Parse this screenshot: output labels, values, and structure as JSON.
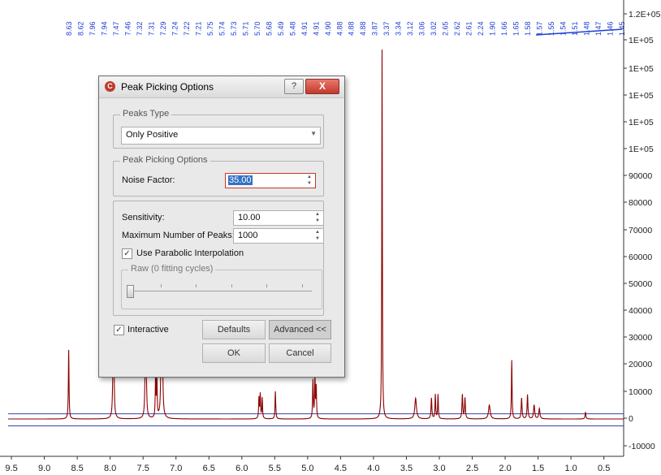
{
  "chart_data": {
    "type": "line",
    "title": "",
    "xlabel": "",
    "ylabel": "",
    "x_ticks": [
      "9.5",
      "9.0",
      "8.5",
      "8.0",
      "7.5",
      "7.0",
      "6.5",
      "6.0",
      "5.5",
      "5.0",
      "4.5",
      "4.0",
      "3.5",
      "3.0",
      "2.5",
      "2.0",
      "1.5",
      "1.0",
      "0.5"
    ],
    "y_ticks": [
      "1.2E+05",
      "1E+05",
      "1E+05",
      "1E+05",
      "1E+05",
      "1E+05",
      "90000",
      "80000",
      "70000",
      "60000",
      "50000",
      "40000",
      "30000",
      "20000",
      "10000",
      "0",
      "-10000"
    ],
    "xlim": [
      9.55,
      0.2
    ],
    "ylim": [
      -12000,
      119000
    ],
    "peak_labels": [
      "8.63",
      "8.62",
      "7.96",
      "7.94",
      "7.47",
      "7.46",
      "7.32",
      "7.31",
      "7.29",
      "7.24",
      "7.22",
      "7.21",
      "5.75",
      "5.74",
      "5.73",
      "5.71",
      "5.70",
      "5.68",
      "5.49",
      "5.48",
      "4.91",
      "4.91",
      "4.90",
      "4.88",
      "4.88",
      "4.88",
      "3.87",
      "3.37",
      "3.34",
      "3.12",
      "3.06",
      "3.02",
      "2.65",
      "2.62",
      "2.61",
      "2.24",
      "1.90",
      "1.66",
      "1.65",
      "1.58",
      "1.57",
      "1.55",
      "1.54",
      "1.51",
      "1.48",
      "1.47",
      "1.46",
      "1.45"
    ],
    "series": [
      {
        "color": "#8b0000",
        "peaks": [
          {
            "ppm": 8.63,
            "height": 20000,
            "width": 0.012
          },
          {
            "ppm": 7.95,
            "height": 60000,
            "width": 0.012
          },
          {
            "ppm": 7.46,
            "height": 60000,
            "width": 0.012
          },
          {
            "ppm": 7.31,
            "height": 12000,
            "width": 0.012
          },
          {
            "ppm": 7.29,
            "height": 11000,
            "width": 0.012
          },
          {
            "ppm": 7.22,
            "height": 60000,
            "width": 0.012
          },
          {
            "ppm": 7.21,
            "height": 40000,
            "width": 0.012
          },
          {
            "ppm": 5.74,
            "height": 6000,
            "width": 0.012
          },
          {
            "ppm": 5.72,
            "height": 7000,
            "width": 0.012
          },
          {
            "ppm": 5.69,
            "height": 6000,
            "width": 0.012
          },
          {
            "ppm": 5.49,
            "height": 8000,
            "width": 0.012
          },
          {
            "ppm": 4.92,
            "height": 11000,
            "width": 0.012
          },
          {
            "ppm": 4.89,
            "height": 12000,
            "width": 0.012
          },
          {
            "ppm": 4.87,
            "height": 9000,
            "width": 0.012
          },
          {
            "ppm": 3.87,
            "height": 107000,
            "width": 0.01
          },
          {
            "ppm": 3.36,
            "height": 6000,
            "width": 0.03
          },
          {
            "ppm": 3.12,
            "height": 6000,
            "width": 0.015
          },
          {
            "ppm": 3.06,
            "height": 7000,
            "width": 0.012
          },
          {
            "ppm": 3.02,
            "height": 7000,
            "width": 0.012
          },
          {
            "ppm": 2.65,
            "height": 7000,
            "width": 0.015
          },
          {
            "ppm": 2.61,
            "height": 6000,
            "width": 0.015
          },
          {
            "ppm": 2.24,
            "height": 4000,
            "width": 0.03
          },
          {
            "ppm": 1.9,
            "height": 17000,
            "width": 0.012
          },
          {
            "ppm": 1.75,
            "height": 6000,
            "width": 0.015
          },
          {
            "ppm": 1.66,
            "height": 7000,
            "width": 0.015
          },
          {
            "ppm": 1.56,
            "height": 4000,
            "width": 0.02
          },
          {
            "ppm": 1.48,
            "height": 3000,
            "width": 0.02
          },
          {
            "ppm": 0.78,
            "height": 2000,
            "width": 0.015
          }
        ]
      }
    ],
    "reference_lines": [
      {
        "y": 1500,
        "color": "#3344aa"
      },
      {
        "y": -2000,
        "color": "#3344aa"
      }
    ],
    "grid": false
  },
  "dialog": {
    "title": "Peak Picking Options",
    "help_label": "?",
    "close_label": "X",
    "peaks_type": {
      "group_label": "Peaks Type",
      "selected": "Only Positive"
    },
    "peak_picking": {
      "group_label": "Peak Picking Options",
      "noise_factor_label": "Noise Factor:",
      "noise_factor_value": "35.00"
    },
    "advanced": {
      "sensitivity_label": "Sensitivity:",
      "sensitivity_value": "10.00",
      "max_peaks_label": "Maximum Number of Peaks:",
      "max_peaks_value": "1000",
      "parabolic_label": "Use Parabolic Interpolation",
      "parabolic_checked": true,
      "raw_group_label": "Raw (0 fitting cycles)",
      "raw_fitting_cycles": 0
    },
    "interactive_label": "Interactive",
    "interactive_checked": true,
    "defaults_label": "Defaults",
    "advanced_label": "Advanced <<",
    "ok_label": "OK",
    "cancel_label": "Cancel"
  }
}
